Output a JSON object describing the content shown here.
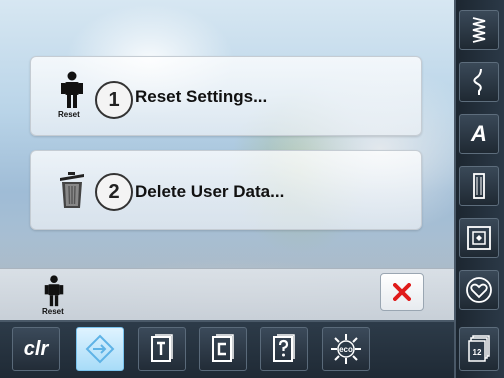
{
  "main": {
    "reset_settings": {
      "number": "1",
      "label": "Reset Settings...",
      "icon_caption": "Reset"
    },
    "delete_user_data": {
      "number": "2",
      "label": "Delete User Data..."
    }
  },
  "status": {
    "icon_caption": "Reset"
  },
  "toolbar": {
    "clr_label": "clr",
    "buttons": [
      "clr",
      "home-active",
      "t-book",
      "c-book",
      "help",
      "eco"
    ]
  },
  "sidebar": {
    "items": [
      "practical-stitches",
      "decorative-stitches",
      "alphabets",
      "buttonholes",
      "quilt-stitches",
      "personal-program",
      "memory"
    ],
    "alphabet_label": "A",
    "memory_label": "12"
  },
  "colors": {
    "close_red": "#e01b1b",
    "active_blue": "#a8dcf8"
  }
}
